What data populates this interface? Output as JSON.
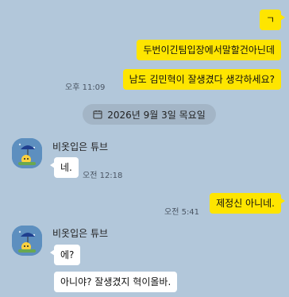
{
  "messages": {
    "m1": {
      "text": "ㄱ"
    },
    "m2": {
      "text": "두번이긴팀입장에서말할건아닌데"
    },
    "m3": {
      "text": "남도 김민혁이 잘생겼다 생각하세요?",
      "time": "오후 11:09"
    },
    "date_divider": {
      "icon": "calendar-icon",
      "text": "2026년 9월 3일 목요일"
    },
    "m4": {
      "sender": "비옷입은 튜브",
      "text": "네.",
      "time": "오전 12:18"
    },
    "m5": {
      "text": "제정신 아니네.",
      "time": "오전 5:41"
    },
    "m6": {
      "sender": "비옷입은 튜브",
      "text": "에?"
    },
    "m7": {
      "text": "아니야? 잘생겼지 혁이올바."
    }
  },
  "colors": {
    "background": "#b2c7da",
    "my_bubble": "#fee500",
    "other_bubble": "#ffffff"
  }
}
